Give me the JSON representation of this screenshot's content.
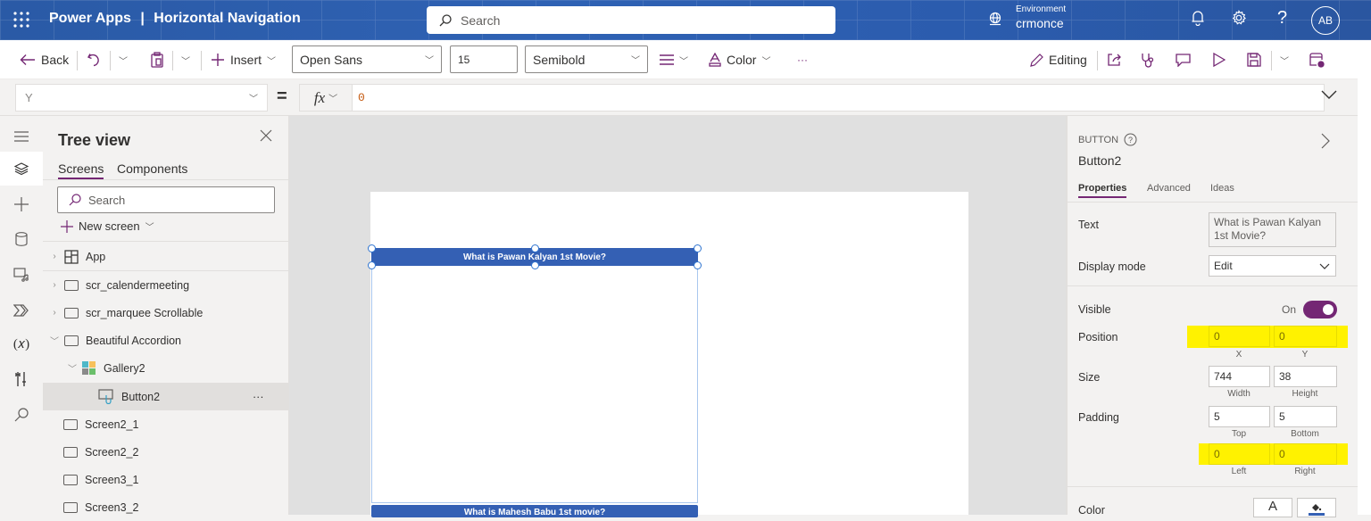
{
  "topbar": {
    "app_name": "Power Apps",
    "separator": "|",
    "app_title": "Horizontal Navigation",
    "search_placeholder": "Search",
    "environment_label": "Environment",
    "environment_value": "crmonce",
    "avatar_initials": "AB",
    "help_glyph": "?"
  },
  "commandbar": {
    "back_label": "Back",
    "insert_label": "Insert",
    "font_family": "Open Sans",
    "font_size": "15",
    "font_weight": "Semibold",
    "color_label": "Color",
    "more_glyph": "···",
    "editing_label": "Editing"
  },
  "formulabar": {
    "property": "Y",
    "equals": "=",
    "fx_label": "fx",
    "formula": "0"
  },
  "tree": {
    "title": "Tree view",
    "tabs": [
      {
        "label": "Screens"
      },
      {
        "label": "Components"
      }
    ],
    "search_placeholder": "Search",
    "new_screen_label": "New screen",
    "items": [
      {
        "label": "App"
      },
      {
        "label": "scr_calendermeeting"
      },
      {
        "label": "scr_marquee Scrollable"
      },
      {
        "label": "Beautiful Accordion"
      },
      {
        "label": "Gallery2"
      },
      {
        "label": "Button2"
      },
      {
        "label": "Screen2_1"
      },
      {
        "label": "Screen2_2"
      },
      {
        "label": "Screen3_1"
      },
      {
        "label": "Screen3_2"
      }
    ],
    "more_glyph": "···"
  },
  "canvas": {
    "button1_text": "What is Pawan Kalyan 1st Movie?",
    "button2_text": "What is Mahesh Babu 1st movie?"
  },
  "properties": {
    "control_type": "BUTTON",
    "control_name": "Button2",
    "tabs": [
      {
        "label": "Properties"
      },
      {
        "label": "Advanced"
      },
      {
        "label": "Ideas"
      }
    ],
    "text_label": "Text",
    "text_value": "What is Pawan Kalyan 1st Movie?",
    "display_mode_label": "Display mode",
    "display_mode_value": "Edit",
    "visible_label": "Visible",
    "visible_value": "On",
    "position_label": "Position",
    "position_x": "0",
    "position_y": "0",
    "x_label": "X",
    "y_label": "Y",
    "size_label": "Size",
    "width": "744",
    "height": "38",
    "width_label": "Width",
    "height_label": "Height",
    "padding_label": "Padding",
    "padding_top": "5",
    "padding_bottom": "5",
    "padding_left": "0",
    "padding_right": "0",
    "top_label": "Top",
    "bottom_label": "Bottom",
    "left_label": "Left",
    "right_label": "Right",
    "color_label": "Color",
    "color_text_glyph": "A"
  },
  "colors": {
    "accent": "#742774",
    "topbar": "#2f62b4",
    "button_fill": "#3460b4",
    "highlight": "#fff200"
  }
}
